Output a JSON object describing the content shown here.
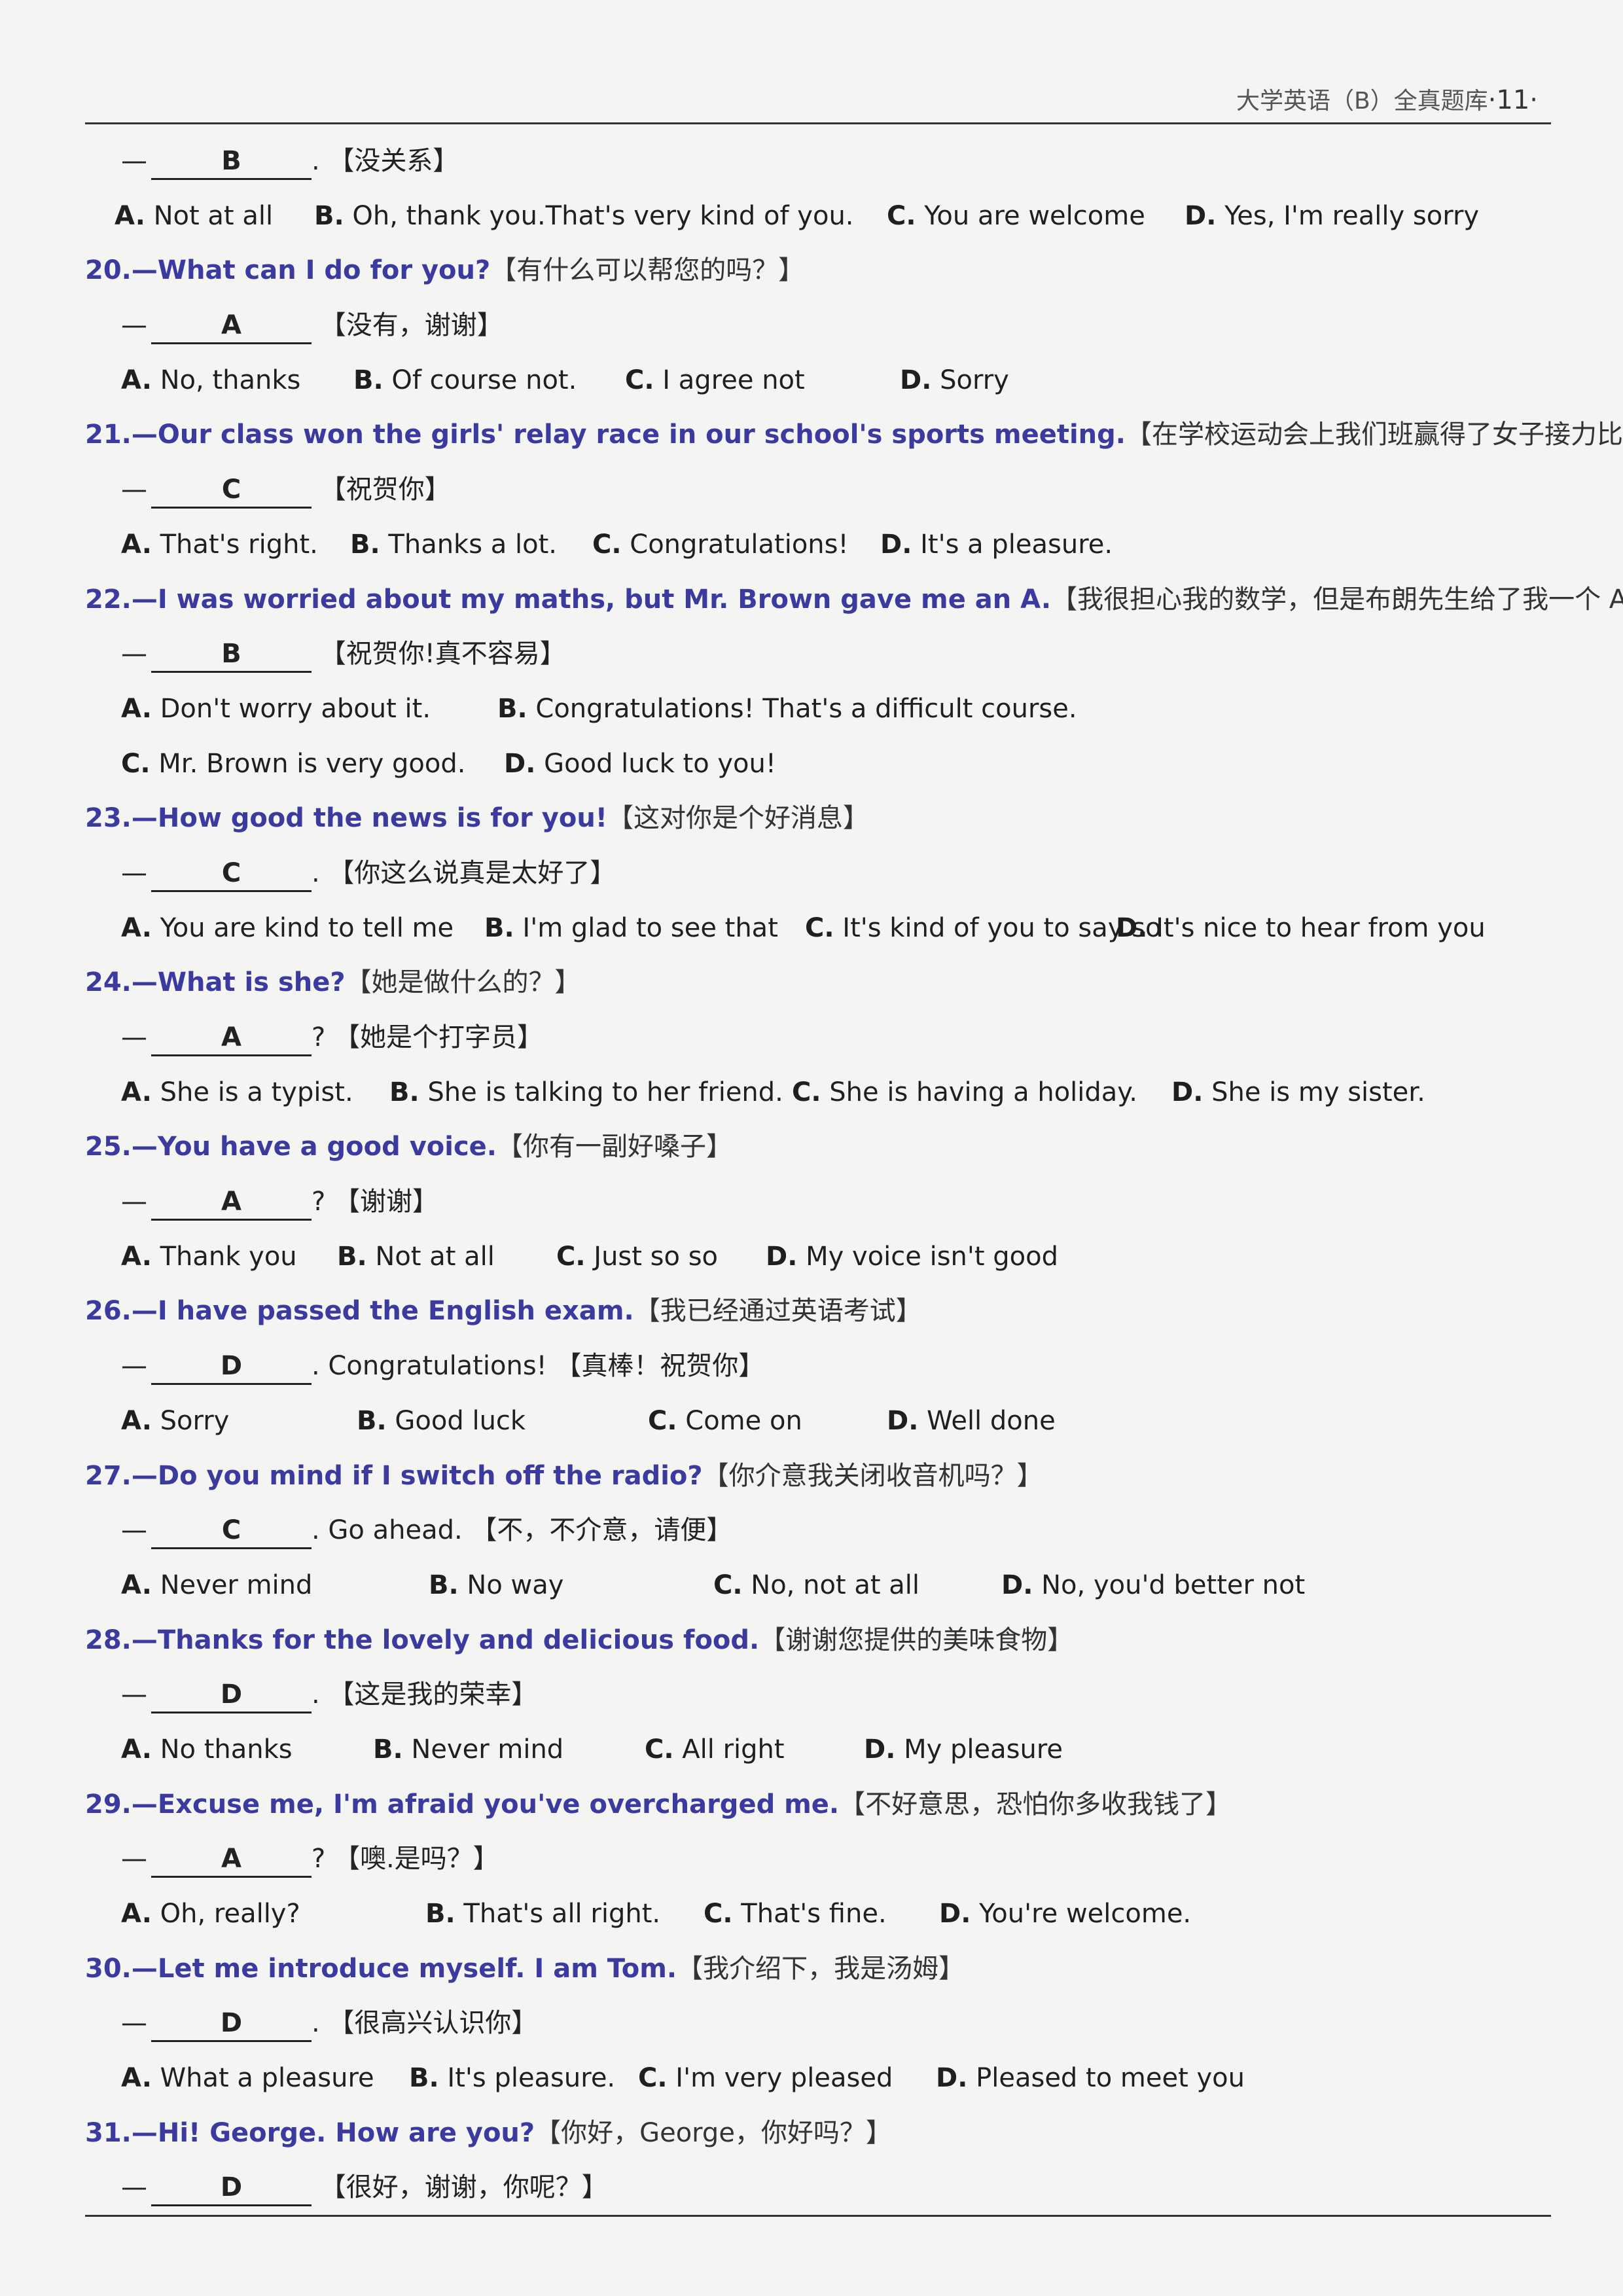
{
  "header": {
    "title": "大学英语（B）全真题库",
    "page": "·11·"
  },
  "top": {
    "answer": {
      "dash": "—",
      "letter": "B",
      "tail": ". 【没关系】"
    },
    "options": [
      {
        "letter": "A.",
        "text": " Not at all"
      },
      {
        "letter": "B.",
        "text": " Oh, thank you.That's very kind of you."
      },
      {
        "letter": "C.",
        "text": " You are welcome"
      },
      {
        "letter": "D.",
        "text": " Yes, I'm really sorry"
      }
    ]
  },
  "items": [
    {
      "q": "20.—What can I do for you?",
      "qcn": "【有什么可以帮您的吗？】",
      "letter": "A",
      "tail": " 【没有，谢谢】",
      "option_rows": [
        [
          {
            "letter": "A.",
            "text": " No, thanks"
          },
          {
            "letter": "B.",
            "text": " Of course not."
          },
          {
            "letter": "C.",
            "text": " I agree not"
          },
          {
            "letter": "D.",
            "text": " Sorry"
          }
        ]
      ]
    },
    {
      "q": "21.—Our class won the girls' relay race in our school's sports meeting.",
      "qcn": "【在学校运动会上我们班赢得了女子接力比赛】",
      "letter": "C",
      "tail": " 【祝贺你】",
      "option_rows": [
        [
          {
            "letter": "A.",
            "text": " That's right."
          },
          {
            "letter": "B.",
            "text": " Thanks a lot."
          },
          {
            "letter": "C.",
            "text": " Congratulations!"
          },
          {
            "letter": "D.",
            "text": " It's a pleasure."
          }
        ]
      ]
    },
    {
      "q": "22.—I was worried about my maths, but Mr. Brown gave me an A.",
      "qcn": "【我很担心我的数学，但是布朗先生给了我一个 A】",
      "letter": "B",
      "tail": " 【祝贺你!真不容易】",
      "option_rows": [
        [
          {
            "letter": "A.",
            "text": " Don't worry about it."
          },
          {
            "letter": "B.",
            "text": " Congratulations! That's a difficult course."
          }
        ],
        [
          {
            "letter": "C.",
            "text": " Mr. Brown is very good."
          },
          {
            "letter": "D.",
            "text": " Good luck to you!"
          }
        ]
      ]
    },
    {
      "q": "23.—How good the news is for you!",
      "qcn": "【这对你是个好消息】",
      "letter": "C",
      "tail": ". 【你这么说真是太好了】",
      "option_rows": [
        [
          {
            "letter": "A.",
            "text": " You are kind to tell me"
          },
          {
            "letter": "B.",
            "text": " I'm glad to see that"
          },
          {
            "letter": "C.",
            "text": " It's kind of you to say so"
          },
          {
            "letter": "D.",
            "text": " It's nice to hear from you"
          }
        ]
      ]
    },
    {
      "q": "24.—What is she?",
      "qcn": "【她是做什么的？】",
      "letter": "A",
      "tail": "? 【她是个打字员】",
      "option_rows": [
        [
          {
            "letter": "A.",
            "text": " She is a typist."
          },
          {
            "letter": "B.",
            "text": " She is talking to her friend."
          },
          {
            "letter": "C.",
            "text": " She is having a holiday."
          },
          {
            "letter": "D.",
            "text": " She is my sister."
          }
        ]
      ]
    },
    {
      "q": "25.—You have a good voice.",
      "qcn": "【你有一副好嗓子】",
      "letter": "A",
      "tail": "? 【谢谢】",
      "option_rows": [
        [
          {
            "letter": "A.",
            "text": " Thank you"
          },
          {
            "letter": "B.",
            "text": " Not at all"
          },
          {
            "letter": "C.",
            "text": " Just so so"
          },
          {
            "letter": "D.",
            "text": " My voice isn't good"
          }
        ]
      ]
    },
    {
      "q": "26.—I have passed the English exam.",
      "qcn": "【我已经通过英语考试】",
      "letter": "D",
      "tail": ". Congratulations! 【真棒！祝贺你】",
      "option_rows": [
        [
          {
            "letter": "A.",
            "text": " Sorry"
          },
          {
            "letter": "B.",
            "text": " Good luck"
          },
          {
            "letter": "C.",
            "text": " Come on"
          },
          {
            "letter": "D.",
            "text": " Well done"
          }
        ]
      ]
    },
    {
      "q": "27.—Do you mind if I switch off the radio?",
      "qcn": "【你介意我关闭收音机吗？】",
      "letter": "C",
      "tail": ". Go ahead. 【不，不介意，请便】",
      "option_rows": [
        [
          {
            "letter": "A.",
            "text": " Never mind"
          },
          {
            "letter": "B.",
            "text": " No way"
          },
          {
            "letter": "C.",
            "text": " No, not at all"
          },
          {
            "letter": "D.",
            "text": " No, you'd better not"
          }
        ]
      ]
    },
    {
      "q": "28.—Thanks for the lovely and delicious food.",
      "qcn": "【谢谢您提供的美味食物】",
      "letter": "D",
      "tail": ". 【这是我的荣幸】",
      "option_rows": [
        [
          {
            "letter": "A.",
            "text": " No thanks"
          },
          {
            "letter": "B.",
            "text": " Never mind"
          },
          {
            "letter": "C.",
            "text": " All right"
          },
          {
            "letter": "D.",
            "text": " My pleasure"
          }
        ]
      ]
    },
    {
      "q": "29.—Excuse me, I'm afraid you've overcharged me.",
      "qcn": "【不好意思，恐怕你多收我钱了】",
      "letter": "A",
      "tail": "? 【噢.是吗？】",
      "option_rows": [
        [
          {
            "letter": "A.",
            "text": " Oh, really?"
          },
          {
            "letter": "B.",
            "text": " That's all right."
          },
          {
            "letter": "C.",
            "text": " That's fine."
          },
          {
            "letter": "D.",
            "text": " You're welcome."
          }
        ]
      ]
    },
    {
      "q": "30.—Let me introduce myself. I am Tom.",
      "qcn": "【我介绍下，我是汤姆】",
      "letter": "D",
      "tail": ". 【很高兴认识你】",
      "option_rows": [
        [
          {
            "letter": "A.",
            "text": " What a pleasure"
          },
          {
            "letter": "B.",
            "text": " It's pleasure."
          },
          {
            "letter": "C.",
            "text": " I'm very pleased"
          },
          {
            "letter": "D.",
            "text": " Pleased to meet you"
          }
        ]
      ]
    },
    {
      "q": "31.—Hi! George. How are you?",
      "qcn": "【你好，George，你好吗？】",
      "letter": "D",
      "tail": " 【很好，谢谢，你呢？】",
      "option_rows": []
    }
  ]
}
